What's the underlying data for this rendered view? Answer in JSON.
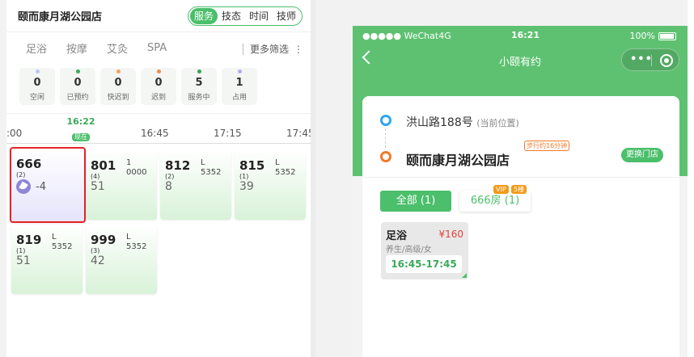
{
  "left": {
    "store_name": "颐而康月湖公园店",
    "segments": [
      "服务",
      "技态",
      "时间",
      "技师"
    ],
    "active_segment": "服务",
    "filters": [
      "足浴",
      "按摩",
      "艾灸",
      "SPA"
    ],
    "more_filter": "更多筛选",
    "stats": [
      {
        "num": "0",
        "label": "空闲",
        "color": "#b9c8f0"
      },
      {
        "num": "0",
        "label": "已预约",
        "color": "#3aa95a"
      },
      {
        "num": "0",
        "label": "快迟到",
        "color": "#f0a060"
      },
      {
        "num": "0",
        "label": "迟到",
        "color": "#f08a4a"
      },
      {
        "num": "5",
        "label": "服务中",
        "color": "#2fa84f"
      },
      {
        "num": "1",
        "label": "占用",
        "color": "#b8a8f0"
      }
    ],
    "timeline": {
      "ticks": [
        ":00",
        "16:45",
        "17:15",
        "17:45"
      ],
      "now_time": "16:22",
      "now_label": "现在"
    },
    "cards": [
      {
        "room": "666",
        "count": "(2)",
        "value": "-4",
        "selected": true
      },
      {
        "room": "801",
        "count": "(4)",
        "v1": "1",
        "v2": "0000",
        "v3": "51"
      },
      {
        "room": "812",
        "count": "(2)",
        "v1": "L",
        "v2": "5352",
        "v3": "8"
      },
      {
        "room": "815",
        "count": "(1)",
        "v1": "L",
        "v2": "5352",
        "v3": "39"
      },
      {
        "room": "819",
        "count": "(1)",
        "v1": "L",
        "v2": "5352",
        "v3": "51"
      },
      {
        "room": "999",
        "count": "(3)",
        "v1": "L",
        "v2": "5352",
        "v3": "42"
      }
    ]
  },
  "phone": {
    "status": {
      "carrier": "●●●●● WeChat4G",
      "time": "16:21",
      "battery": "100%"
    },
    "nav_title": "小颐有约",
    "current_address": "洪山路188号",
    "current_tag": "(当前位置)",
    "walk_info": "步行约16分钟",
    "store_name": "颐而康月湖公园店",
    "switch_store": "更换门店",
    "tab_all": "全部 (1)",
    "tab_room": "666房 (1)",
    "vip_badge": "VIP",
    "floor_badge": "5楼",
    "service": {
      "name": "足浴",
      "price": "¥160",
      "sub": "养生/高级/女",
      "time": "16:45-17:45"
    }
  }
}
